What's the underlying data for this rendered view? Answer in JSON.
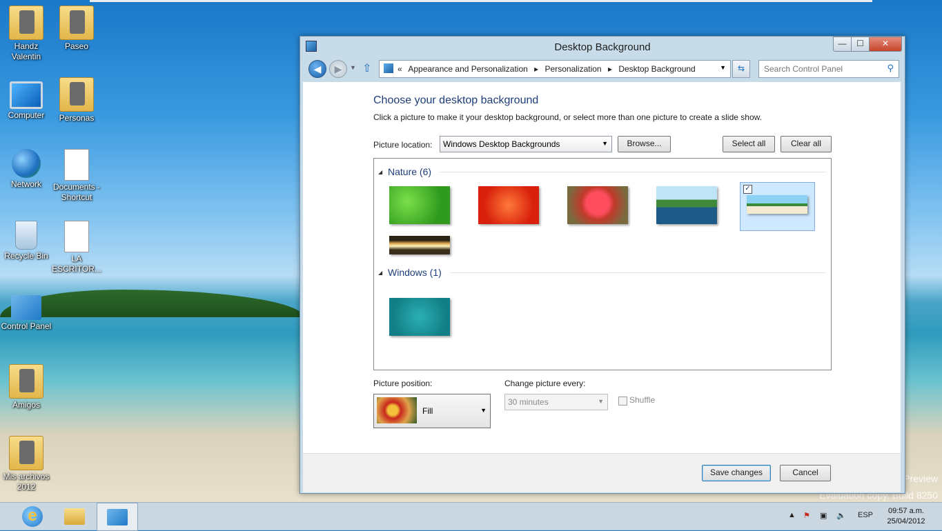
{
  "desktop": {
    "icons": [
      {
        "label": "Handz Valentin",
        "icon": "user-folder-icon"
      },
      {
        "label": "Paseo",
        "icon": "photo-folder-icon"
      },
      {
        "label": "Computer",
        "icon": "computer-icon"
      },
      {
        "label": "Personas",
        "icon": "photo-folder-icon"
      },
      {
        "label": "Network",
        "icon": "network-icon"
      },
      {
        "label": "Documents - Shortcut",
        "icon": "documents-shortcut-icon"
      },
      {
        "label": "Recycle Bin",
        "icon": "recycle-bin-icon"
      },
      {
        "label": "LA ESCRITOR...",
        "icon": "document-icon"
      },
      {
        "label": "Control Panel",
        "icon": "control-panel-icon"
      },
      {
        "label": "Amigos",
        "icon": "photo-folder-icon"
      },
      {
        "label": "Mis archivos 2012",
        "icon": "folder-icon"
      }
    ],
    "watermark_line1": "Preview",
    "watermark_line2": "Evaluation copy. Build 8250"
  },
  "window": {
    "title": "Desktop Background",
    "minimize": "—",
    "maximize": "☐",
    "close": "✕",
    "breadcrumb_prefix": "«",
    "breadcrumbs": [
      "Appearance and Personalization",
      "Personalization",
      "Desktop Background"
    ],
    "search_placeholder": "Search Control Panel"
  },
  "main": {
    "heading": "Choose your desktop background",
    "instructions": "Click a picture to make it your desktop background, or select more than one picture to create a slide show.",
    "picture_location_label": "Picture location:",
    "picture_location_value": "Windows Desktop Backgrounds",
    "browse_label": "Browse...",
    "select_all_label": "Select all",
    "clear_all_label": "Clear all",
    "groups": [
      {
        "title": "Nature (6)",
        "thumbnails": [
          "clover",
          "red-leaves",
          "pink-flower",
          "island",
          "beach",
          "sunset"
        ],
        "selected_index": 4
      },
      {
        "title": "Windows (1)",
        "thumbnails": [
          "betta-fish"
        ]
      }
    ],
    "picture_position_label": "Picture position:",
    "picture_position_value": "Fill",
    "change_picture_label": "Change picture every:",
    "change_picture_value": "30 minutes",
    "shuffle_label": "Shuffle",
    "save_label": "Save changes",
    "cancel_label": "Cancel"
  },
  "taskbar": {
    "apps": [
      "internet-explorer-icon",
      "file-explorer-icon",
      "control-panel-icon"
    ],
    "language": "ESP",
    "time": "09:57 a.m.",
    "date": "25/04/2012"
  },
  "colors": {
    "accent": "#1e3d7a",
    "selection": "#cde8ff"
  }
}
